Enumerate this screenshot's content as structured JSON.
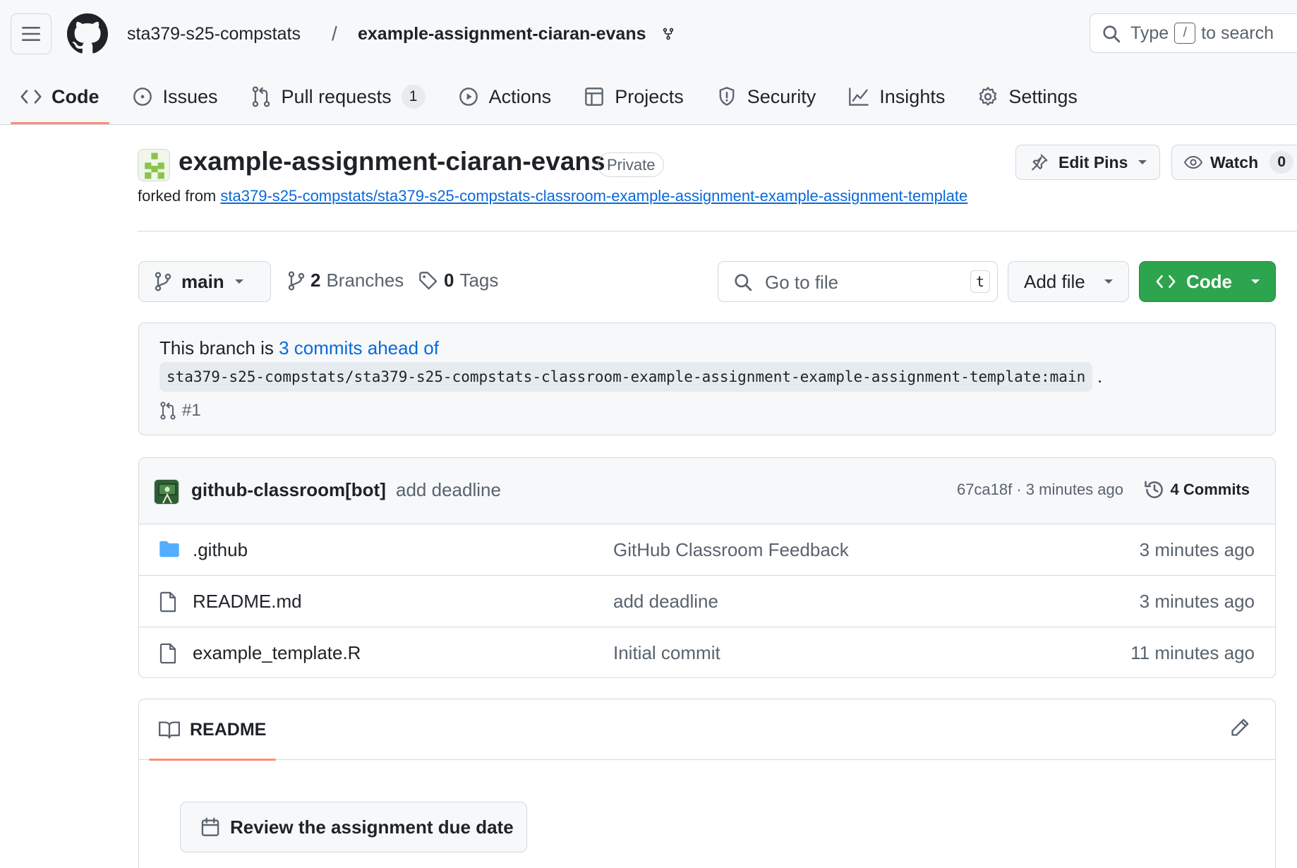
{
  "header": {
    "owner": "sta379-s25-compstats",
    "separator": "/",
    "repo": "example-assignment-ciaran-evans",
    "search_prefix": "Type",
    "search_key": "/",
    "search_suffix": "to search"
  },
  "tabs": [
    {
      "label": "Code",
      "icon": "code-icon",
      "selected": true
    },
    {
      "label": "Issues",
      "icon": "issue-opened-icon"
    },
    {
      "label": "Pull requests",
      "icon": "git-pull-request-icon",
      "count": "1"
    },
    {
      "label": "Actions",
      "icon": "play-icon"
    },
    {
      "label": "Projects",
      "icon": "table-icon"
    },
    {
      "label": "Security",
      "icon": "shield-icon"
    },
    {
      "label": "Insights",
      "icon": "graph-icon"
    },
    {
      "label": "Settings",
      "icon": "gear-icon"
    }
  ],
  "repo": {
    "title": "example-assignment-ciaran-evans",
    "visibility": "Private",
    "forked_prefix": "forked from",
    "forked_from": "sta379-s25-compstats/sta379-s25-compstats-classroom-example-assignment-example-assignment-template",
    "edit_pins": "Edit Pins",
    "watch_label": "Watch",
    "watch_count": "0"
  },
  "branch_bar": {
    "branch": "main",
    "branches_count": "2",
    "branches_label": "Branches",
    "tags_count": "0",
    "tags_label": "Tags",
    "goto_placeholder": "Go to file",
    "goto_key": "t",
    "add_file": "Add file",
    "code_button": "Code"
  },
  "ahead": {
    "prefix": "This branch is",
    "link": "3 commits ahead of",
    "ref": "sta379-s25-compstats/sta379-s25-compstats-classroom-example-assignment-example-assignment-template:main",
    "suffix": ".",
    "pr": "#1"
  },
  "latest_commit": {
    "author": "github-classroom[bot]",
    "message": "add deadline",
    "sha_time": "67ca18f · 3 minutes ago",
    "commits": "4 Commits"
  },
  "files": [
    {
      "name": ".github",
      "type": "folder",
      "message": "GitHub Classroom Feedback",
      "age": "3 minutes ago"
    },
    {
      "name": "README.md",
      "type": "file",
      "message": "add deadline",
      "age": "3 minutes ago"
    },
    {
      "name": "example_template.R",
      "type": "file",
      "message": "Initial commit",
      "age": "11 minutes ago"
    }
  ],
  "readme": {
    "tab_label": "README",
    "due_button": "Review the assignment due date"
  },
  "colors": {
    "accent_link": "#0969da",
    "primary_green": "#2da44e",
    "tab_underline": "#fd8c73",
    "folder_blue": "#54aeff"
  }
}
